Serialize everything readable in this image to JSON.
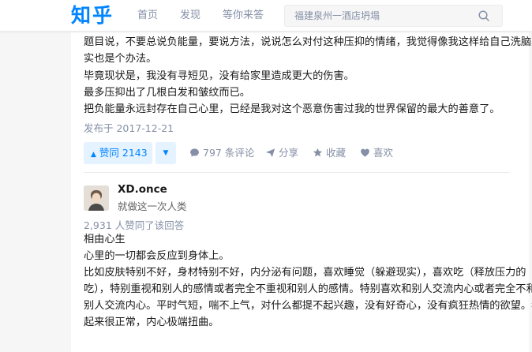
{
  "header": {
    "logo": "知乎",
    "nav": [
      "首页",
      "发现",
      "等你来答"
    ],
    "search_placeholder": "福建泉州一酒店坍塌"
  },
  "answer1": {
    "lines": [
      "题目说，不要总说负能量，要说方法，说说怎么对付这种压抑的情绪，我觉得像我这样给自己洗脑其",
      "实也是个办法。",
      "毕竟现状是，我没有寻短见，没有给家里造成更大的伤害。",
      "最多压抑出了几根白发和皱纹而已。",
      "把负能量永远封存在自己心里，已经是我对这个恶意伤害过我的世界保留的最大的善意了。"
    ],
    "date": "发布于 2017-12-21",
    "actions": {
      "upvote": "赞同 2143",
      "comments": "797 条评论",
      "share": "分享",
      "collect": "收藏",
      "like": "喜欢"
    }
  },
  "answer2": {
    "author": "XD.once",
    "bio": "就做这一次人类",
    "agree": "2,931 人赞同了该回答",
    "lines": [
      "相由心生",
      "心里的一切都会反应到身体上。",
      "比如皮肤特别不好，身材特别不好，内分泌有问题，喜欢睡觉（躲避现实），喜欢吃（释放压力的",
      "吃），特别重视和别人的感情或者完全不重视和别人的感情。特别喜欢和别人交流内心或者完全不和",
      "别人交流内心。平时气短，喘不上气，对什么都提不起兴趣，没有好奇心，没有疯狂热情的欲望。看",
      "起来很正常，内心极端扭曲。"
    ]
  },
  "colors": {
    "brand": "#0084ff",
    "meta": "#8590a6",
    "upvote_bg": "#e5f2ff"
  },
  "icons": [
    "search-icon",
    "caret-up-icon",
    "caret-down-icon",
    "comment-icon",
    "share-icon",
    "star-icon",
    "heart-icon"
  ]
}
